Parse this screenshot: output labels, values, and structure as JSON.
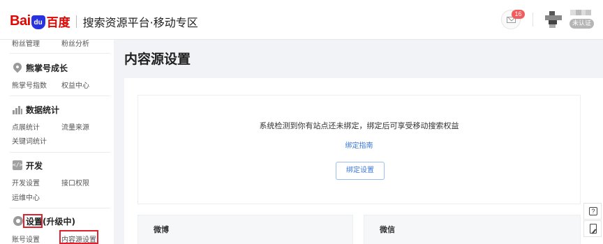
{
  "header": {
    "logo_bai": "Bai",
    "logo_du": "du",
    "logo_cn": "百度",
    "platform_title": "搜索资源平台·移动专区",
    "mail_badge": "16",
    "user_status": "未认证"
  },
  "sidebar": {
    "top_items": [
      "粉丝管理",
      "粉丝分析"
    ],
    "groups": [
      {
        "title": "熊掌号成长",
        "icon": "map-pin-icon",
        "items": [
          "熊掌号指数",
          "权益中心"
        ]
      },
      {
        "title": "数据统计",
        "icon": "bar-chart-icon",
        "items": [
          "点展统计",
          "流量来源",
          "关键词统计"
        ]
      },
      {
        "title": "开发",
        "icon": "code-icon",
        "items": [
          "开发设置",
          "接口权限",
          "运维中心"
        ]
      },
      {
        "title_main": "设置",
        "title_suffix": "(升级中)",
        "icon": "gear-icon",
        "items": [
          "账号设置",
          "内容源设置"
        ]
      }
    ]
  },
  "main": {
    "page_title": "内容源设置",
    "notice": "系统检测到你有站点还未绑定，绑定后可享受移动搜索权益",
    "guide_link": "绑定指南",
    "bind_button": "绑定设置",
    "cards": [
      "微博",
      "微信"
    ]
  },
  "float_buttons": {
    "help_icon": "help-icon",
    "edit_icon": "feedback-edit-icon",
    "help_glyph": "?"
  },
  "colors": {
    "brand_red": "#e10601",
    "brand_blue": "#2932e1",
    "link_blue": "#3b78dd",
    "highlight_red": "#e0202d",
    "badge_red": "#f25c5c"
  }
}
